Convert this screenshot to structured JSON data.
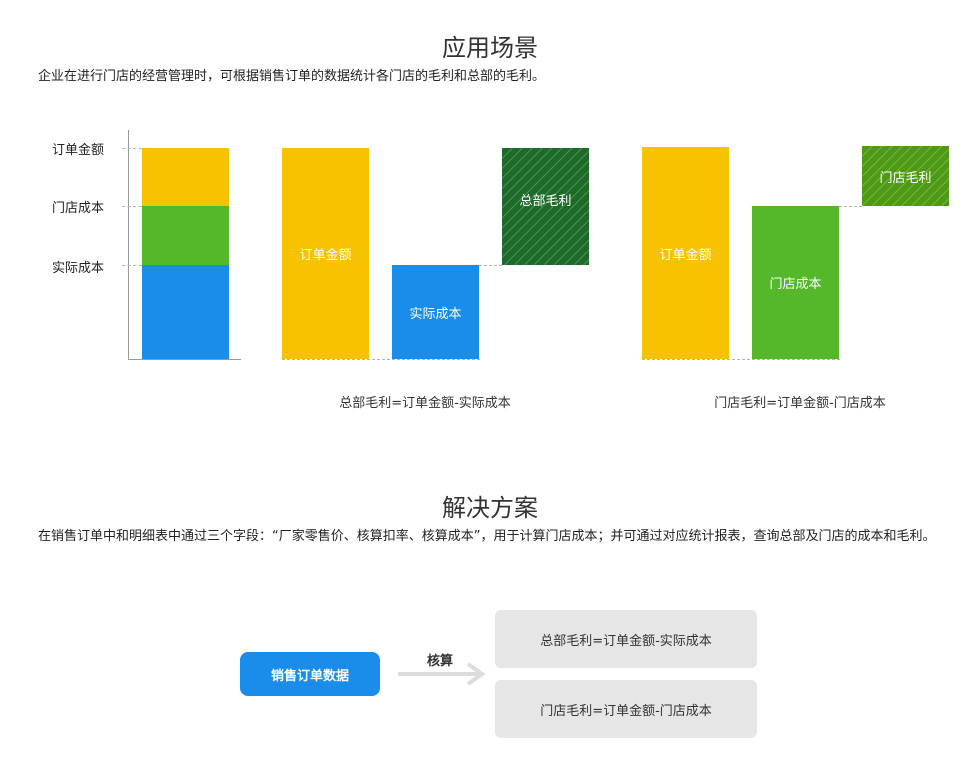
{
  "section1": {
    "title": "应用场景",
    "description": "企业在进行门店的经营管理时，可根据销售订单的数据统计各门店的毛利和总部的毛利。"
  },
  "chart": {
    "axis_labels": [
      "订单金额",
      "门店成本",
      "实际成本"
    ],
    "bars": {
      "order_amount": "订单金额",
      "actual_cost": "实际成本",
      "hq_margin": "总部毛利",
      "order_amount_2": "订单金额",
      "store_cost": "门店成本",
      "store_margin": "门店毛利"
    },
    "captions": {
      "hq": "总部毛利=订单金额-实际成本",
      "store": "门店毛利=订单金额-门店成本"
    }
  },
  "section2": {
    "title": "解决方案",
    "description": "在销售订单中和明细表中通过三个字段：“厂家零售价、核算扣率、核算成本”，用于计算门店成本；并可通过对应统计报表，查询总部及门店的成本和毛利。"
  },
  "flow": {
    "source": "销售订单数据",
    "arrow_label": "核算",
    "results": [
      "总部毛利=订单金额-实际成本",
      "门店毛利=订单金额-门店成本"
    ]
  },
  "colors": {
    "yellow": "#f7c300",
    "green": "#55b72a",
    "blue": "#1a8cea",
    "dark_green_hatch": "#1c6b29",
    "green_hatch": "#4e9a14"
  }
}
